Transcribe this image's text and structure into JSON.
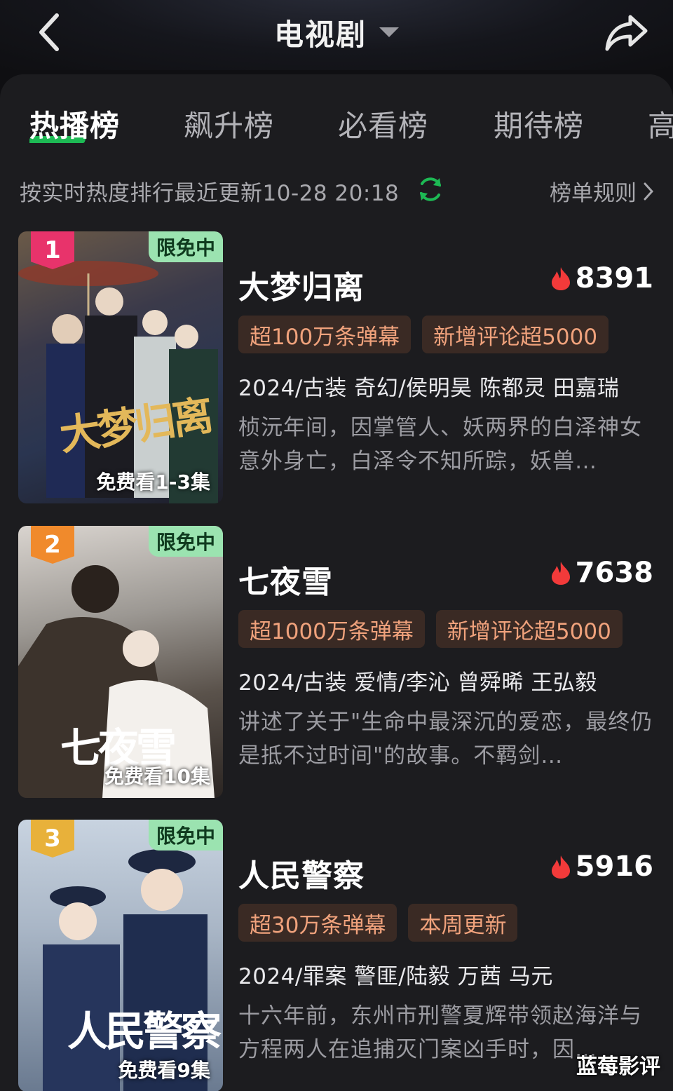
{
  "header": {
    "title": "电视剧",
    "back_icon": "chevron-left-icon",
    "share_icon": "share-icon",
    "dropdown_icon": "caret-down-icon"
  },
  "tabs": [
    {
      "label": "热播榜",
      "active": true
    },
    {
      "label": "飙升榜",
      "active": false
    },
    {
      "label": "必看榜",
      "active": false
    },
    {
      "label": "期待榜",
      "active": false
    },
    {
      "label": "高",
      "active": false
    }
  ],
  "info": {
    "text": "按实时热度排行最近更新10-28 20:18",
    "rules_label": "榜单规则",
    "accent": "#1db954"
  },
  "items": [
    {
      "rank": "1",
      "rank_color": "#e8336b",
      "free_badge": "限免中",
      "poster_art": "大梦归离",
      "free_eps": "免费看1-3集",
      "title": "大梦归离",
      "heat": "8391",
      "tags": [
        "超100万条弹幕",
        "新增评论超5000"
      ],
      "meta": "2024/古装 奇幻/侯明昊 陈都灵 田嘉瑞",
      "desc": "桢沅年间，因掌管人、妖两界的白泽神女意外身亡，白泽令不知所踪，妖兽…"
    },
    {
      "rank": "2",
      "rank_color": "#f08a2c",
      "free_badge": "限免中",
      "poster_art": "七夜雪",
      "free_eps": "免费看10集",
      "title": "七夜雪",
      "heat": "7638",
      "tags": [
        "超1000万条弹幕",
        "新增评论超5000"
      ],
      "meta": "2024/古装 爱情/李沁 曾舜晞 王弘毅",
      "desc": "讲述了关于\"生命中最深沉的爱恋，最终仍是抵不过时间\"的故事。不羁剑…"
    },
    {
      "rank": "3",
      "rank_color": "#e8b13a",
      "free_badge": "限免中",
      "poster_art": "人民警察",
      "free_eps": "免费看9集",
      "title": "人民警察",
      "heat": "5916",
      "tags": [
        "超30万条弹幕",
        "本周更新"
      ],
      "meta": "2024/罪案 警匪/陆毅 万茜 马元",
      "desc": "十六年前，东州市刑警夏辉带领赵海洋与方程两人在追捕灭门案凶手时，因…"
    }
  ],
  "watermark": "蓝莓影评"
}
